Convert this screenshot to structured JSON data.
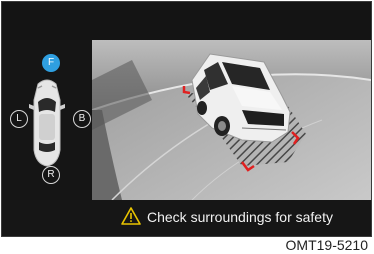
{
  "camera_view": {
    "direction_buttons": {
      "front": "F",
      "left": "L",
      "back": "B",
      "rear": "R"
    },
    "active_direction": "front"
  },
  "warning": {
    "icon": "warning-triangle-icon",
    "text": "Check surroundings for safety"
  },
  "figure_code": "OMT19-5210",
  "colors": {
    "active": "#2f9fe0",
    "warning_icon": "#e9c400",
    "guide_line": "#e02020"
  }
}
